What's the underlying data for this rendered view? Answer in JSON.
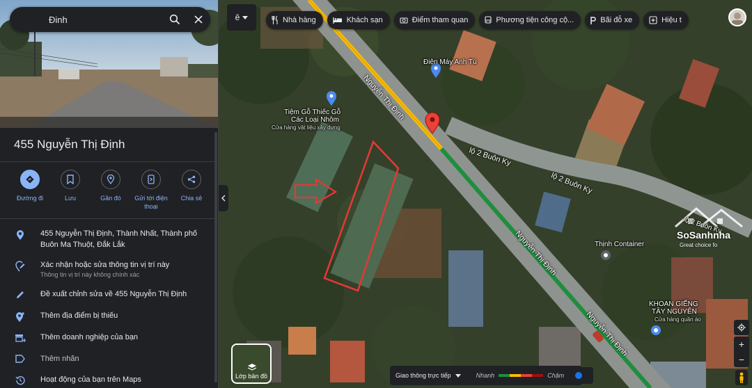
{
  "search": {
    "query": "Đinh"
  },
  "place": {
    "title": "455 Nguyễn Thị Định",
    "actions": [
      {
        "label": "Đường đi"
      },
      {
        "label": "Lưu"
      },
      {
        "label": "Gần đó"
      },
      {
        "label": "Gửi tới điện thoại"
      },
      {
        "label": "Chia sẻ"
      }
    ],
    "address": "455 Nguyễn Thị Định, Thành Nhất, Thành phố Buôn Ma Thuột, Đắk Lắk",
    "verify": {
      "label": "Xác nhận hoặc sửa thông tin vị trí này",
      "sub": "Thông tin vị trí này không chính xác"
    },
    "suggest_edit": "Đề xuất chỉnh sửa về 455 Nguyễn Thị Định",
    "add_missing": "Thêm địa điểm bị thiếu",
    "add_business": "Thêm doanh nghiệp của bạn",
    "add_label": "Thêm nhãn",
    "activity": "Hoạt động của bạn trên Maps"
  },
  "map": {
    "lang_button": "ê",
    "chips": [
      {
        "icon": "restaurant-icon",
        "label": "Nhà hàng"
      },
      {
        "icon": "hotel-icon",
        "label": "Khách sạn"
      },
      {
        "icon": "camera-icon",
        "label": "Điểm tham quan"
      },
      {
        "icon": "bus-icon",
        "label": "Phương tiện công cộ..."
      },
      {
        "icon": "parking-icon",
        "label": "Bãi đỗ xe"
      },
      {
        "icon": "pharmacy-icon",
        "label": "Hiệu t"
      }
    ],
    "labels": {
      "dien_may": "Điện Máy Anh Tú",
      "tiem_go_1": "Tiệm Gỗ Thiếc Gỗ",
      "tiem_go_2": "Các Loại Nhôm",
      "tiem_go_sub": "Cửa hàng vật liệu xây dựng",
      "thinh_container": "Thịnh Container",
      "khoan_gieng_1": "KHOAN GIẾNG",
      "khoan_gieng_2": "TÂY NGUYÊN",
      "khoan_gieng_sub": "Cửa hàng quần áo"
    },
    "roads": {
      "nguyen_thi_dinh": "Nguyễn Thị Định",
      "lo2_buon_ky": "lộ 2 Buôn Ky",
      "lo2_buon_ky_partial": "lộ 2 Buôn Ky"
    },
    "watermark": {
      "name": "SoSanhnha",
      "tagline": "Great choice fo",
      "road": "lộ 2 Buôn Ky"
    },
    "layers_label": "Lớp bản đồ",
    "traffic": {
      "label": "Giao thông trực tiếp",
      "fast": "Nhanh",
      "slow": "Chậm",
      "colors": [
        "#1e8e3e",
        "#fbbc04",
        "#ea4335",
        "#a50e0e"
      ]
    }
  },
  "colors": {
    "accent": "#8ab4f8",
    "panel_bg": "#202124",
    "annotation_red": "#e53935",
    "pin_red": "#ea4335"
  }
}
